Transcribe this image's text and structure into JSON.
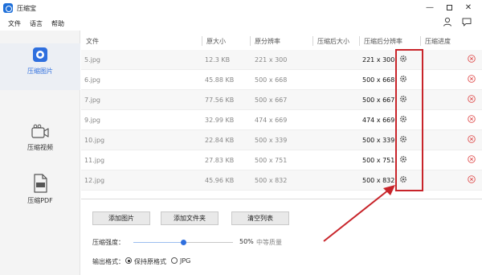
{
  "window": {
    "title": "压缩宝",
    "minimize": "—",
    "close": "✕"
  },
  "menu": {
    "items": [
      "文件",
      "语言",
      "帮助"
    ]
  },
  "sidebar": {
    "items": [
      {
        "label": "压缩图片",
        "icon": "image-compress-icon",
        "active": true
      },
      {
        "label": "压缩视频",
        "icon": "video-compress-icon",
        "active": false
      },
      {
        "label": "压缩PDF",
        "icon": "pdf-compress-icon",
        "active": false
      }
    ]
  },
  "table": {
    "headers": [
      "文件",
      "原大小",
      "原分辨率",
      "压缩后大小",
      "压缩后分辨率",
      "压缩进度"
    ],
    "rows": [
      {
        "name": "5.jpg",
        "size": "12.3 KB",
        "res": "221 x 300",
        "cres": "221 x 300"
      },
      {
        "name": "6.jpg",
        "size": "45.88 KB",
        "res": "500 x 668",
        "cres": "500 x 668"
      },
      {
        "name": "7.jpg",
        "size": "77.56 KB",
        "res": "500 x 667",
        "cres": "500 x 667"
      },
      {
        "name": "9.jpg",
        "size": "32.99 KB",
        "res": "474 x 669",
        "cres": "474 x 669"
      },
      {
        "name": "10.jpg",
        "size": "22.84 KB",
        "res": "500 x 339",
        "cres": "500 x 339"
      },
      {
        "name": "11.jpg",
        "size": "27.83 KB",
        "res": "500 x 751",
        "cres": "500 x 751"
      },
      {
        "name": "12.jpg",
        "size": "45.96 KB",
        "res": "500 x 832",
        "cres": "500 x 832"
      }
    ]
  },
  "buttons": {
    "add_image": "添加图片",
    "add_folder": "添加文件夹",
    "clear_list": "清空列表"
  },
  "compression": {
    "label": "压缩强度：",
    "percent": "50%",
    "quality": "中等质量",
    "value": 0.5
  },
  "format": {
    "label": "输出格式：",
    "options": [
      "保持原格式",
      "JPG"
    ],
    "selected": "保持原格式"
  },
  "colors": {
    "accent": "#2f6fde",
    "annotation": "#c8242a",
    "remove": "#e05252"
  }
}
